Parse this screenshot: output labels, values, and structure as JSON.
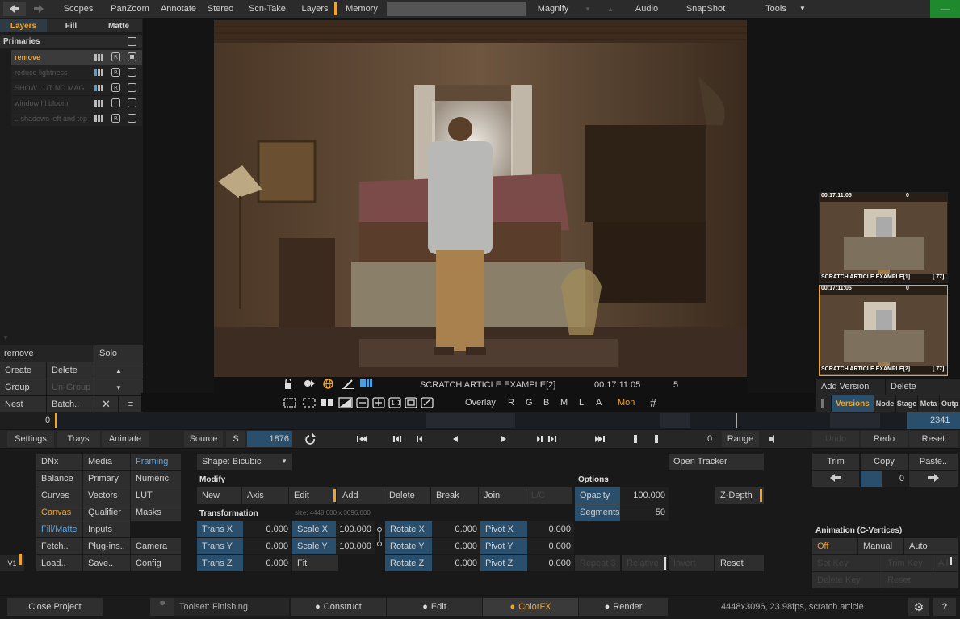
{
  "topbar": {
    "items": [
      "Scopes",
      "PanZoom",
      "Annotate",
      "Stereo",
      "Scn-Take",
      "Layers",
      "Memory"
    ],
    "magnify": "Magnify",
    "audio": "Audio",
    "snapshot": "SnapShot",
    "tools": "Tools"
  },
  "layers": {
    "tabs": [
      "Layers",
      "Fill",
      "Matte"
    ],
    "header": "Primaries",
    "items": [
      "remove",
      "reduce lightness",
      "SHOW LUT NO MAG",
      "window hl bloom",
      ".. shadows left and top"
    ],
    "current": "remove",
    "solo": "Solo",
    "create": "Create",
    "delete": "Delete",
    "group": "Group",
    "ungroup": "Un-Group",
    "nest": "Nest",
    "batch": "Batch.."
  },
  "viewer": {
    "clip_name": "SCRATCH ARTICLE EXAMPLE[2]",
    "timecode": "00:17:11:05",
    "number": "5",
    "overlay": "Overlay",
    "channels": [
      "R",
      "G",
      "B",
      "M",
      "L",
      "A"
    ],
    "mon": "Mon"
  },
  "versions": {
    "thumbs": [
      {
        "tc": "00:17:11:05",
        "flag": "0",
        "name": "SCRATCH ARTICLE EXAMPLE[1]",
        "num": "[.77]"
      },
      {
        "tc": "00:17:11:05",
        "flag": "0",
        "name": "SCRATCH ARTICLE EXAMPLE[2]",
        "num": "[.77]"
      }
    ],
    "add_version": "Add Version",
    "delete": "Delete",
    "tabs": [
      "Versions",
      "Node",
      "Stage",
      "Meta",
      "Outp"
    ]
  },
  "timeline": {
    "start": "0",
    "end": "2341"
  },
  "transport": {
    "settings": "Settings",
    "trays": "Trays",
    "animate": "Animate",
    "source": "Source",
    "s": "S",
    "frame": "1876",
    "zero": "0",
    "range": "Range",
    "undo": "Undo",
    "redo": "Redo",
    "reset": "Reset"
  },
  "menu": {
    "col1": [
      "DNx",
      "Balance",
      "Curves",
      "Canvas",
      "Fill/Matte",
      "Fetch..",
      "Load.."
    ],
    "col2": [
      "Media",
      "Primary",
      "Vectors",
      "Qualifier",
      "Inputs",
      "Plug-ins..",
      "Save.."
    ],
    "col3": [
      "Framing",
      "Numeric",
      "LUT",
      "Masks",
      "",
      "Camera",
      "Config"
    ],
    "v1": "V1"
  },
  "framing": {
    "shape": "Shape: Bicubic",
    "modify": "Modify",
    "modify_buttons": [
      "New",
      "Axis",
      "Edit",
      "Add",
      "Delete",
      "Break",
      "Join",
      "L/C"
    ],
    "transformation": "Transformation",
    "size": "size: 4448.000 x 3096.000",
    "rows": [
      {
        "a": "Trans X",
        "av": "0.000",
        "b": "Scale X",
        "bv": "100.000",
        "c": "Rotate X",
        "cv": "0.000",
        "d": "Pivot X",
        "dv": "0.000"
      },
      {
        "a": "Trans Y",
        "av": "0.000",
        "b": "Scale Y",
        "bv": "100.000",
        "c": "Rotate Y",
        "cv": "0.000",
        "d": "Pivot Y",
        "dv": "0.000"
      },
      {
        "a": "Trans Z",
        "av": "0.000",
        "b": "Fit",
        "bv": "",
        "c": "Rotate Z",
        "cv": "0.000",
        "d": "Pivot Z",
        "dv": "0.000"
      }
    ],
    "options": "Options",
    "opacity": "Opacity",
    "opacity_value": "100.000",
    "segments": "Segments",
    "segments_value": "50",
    "zdepth": "Z-Depth",
    "open_tracker": "Open Tracker",
    "repeat": "Repeat 3",
    "relative": "Relative",
    "invert": "Invert",
    "reset": "Reset"
  },
  "right_panel": {
    "trim": "Trim",
    "copy": "Copy",
    "paste": "Paste..",
    "num": "0",
    "anim_title": "Animation (C-Vertices)",
    "off": "Off",
    "manual": "Manual",
    "auto": "Auto",
    "set_key": "Set Key",
    "trim_key": "Trim Key",
    "all": "All",
    "delete_key": "Delete Key",
    "reset": "Reset"
  },
  "bottom": {
    "close_project": "Close Project",
    "toolset": "Toolset: Finishing",
    "tabs": [
      "Construct",
      "Edit",
      "ColorFX",
      "Render"
    ],
    "active_tab": "ColorFX",
    "status": "4448x3096, 23.98fps, scratch article"
  },
  "colors": {
    "accent": "#f3a423",
    "selected_blue": "#2a4f6d",
    "highlight_text": "#5aa6e8",
    "green": "#1f8a2d"
  }
}
